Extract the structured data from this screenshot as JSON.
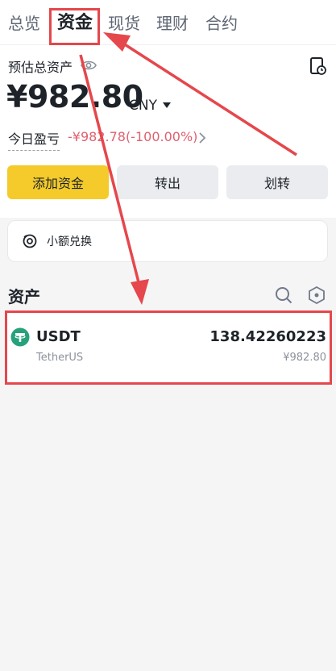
{
  "tabs": [
    {
      "label": "总览",
      "active": false
    },
    {
      "label": "资金",
      "active": true
    },
    {
      "label": "现货",
      "active": false
    },
    {
      "label": "理财",
      "active": false
    },
    {
      "label": "合约",
      "active": false
    }
  ],
  "summary": {
    "label": "预估总资产",
    "balance": "¥982.80",
    "currency": "CNY",
    "pnl_label": "今日盈亏",
    "pnl_value": "-¥982.78(-100.00%)"
  },
  "actions": {
    "deposit": "添加资金",
    "withdraw": "转出",
    "transfer": "划转"
  },
  "small_exchange": {
    "label": "小额兑换"
  },
  "assets": {
    "title": "资产",
    "items": [
      {
        "symbol": "USDT",
        "name": "TetherUS",
        "amount": "138.42260223",
        "value": "¥982.80"
      }
    ]
  },
  "colors": {
    "accent_yellow": "#f4cb2a",
    "loss_red": "#e0616f",
    "annotation_red": "#e5474c",
    "usdt_teal": "#26a17b"
  },
  "icons": [
    "eye-icon",
    "history-icon",
    "caret-down-icon",
    "chevron-right-icon",
    "small-exchange-icon",
    "search-icon",
    "hexagon-icon",
    "usdt-icon"
  ]
}
